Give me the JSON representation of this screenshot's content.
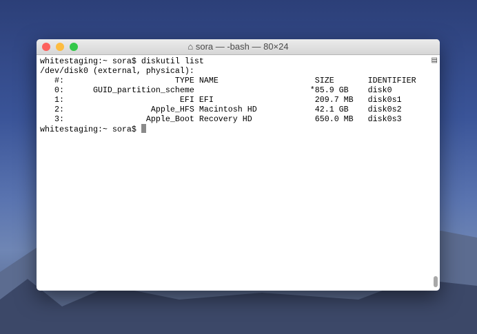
{
  "window": {
    "title": "sora — -bash — 80×24",
    "title_icon": "home-icon"
  },
  "terminal": {
    "lines": [
      "whitestaging:~ sora$ diskutil list",
      "/dev/disk0 (external, physical):",
      "   #:                       TYPE NAME                    SIZE       IDENTIFIER",
      "   0:      GUID_partition_scheme                        *85.9 GB    disk0",
      "   1:                        EFI EFI                     209.7 MB   disk0s1",
      "   2:                  Apple_HFS Macintosh HD            42.1 GB    disk0s2",
      "   3:                 Apple_Boot Recovery HD             650.0 MB   disk0s3"
    ],
    "prompt": "whitestaging:~ sora$ "
  },
  "colors": {
    "close": "#fc605c",
    "minimize": "#fdbc40",
    "zoom": "#34c84a"
  }
}
